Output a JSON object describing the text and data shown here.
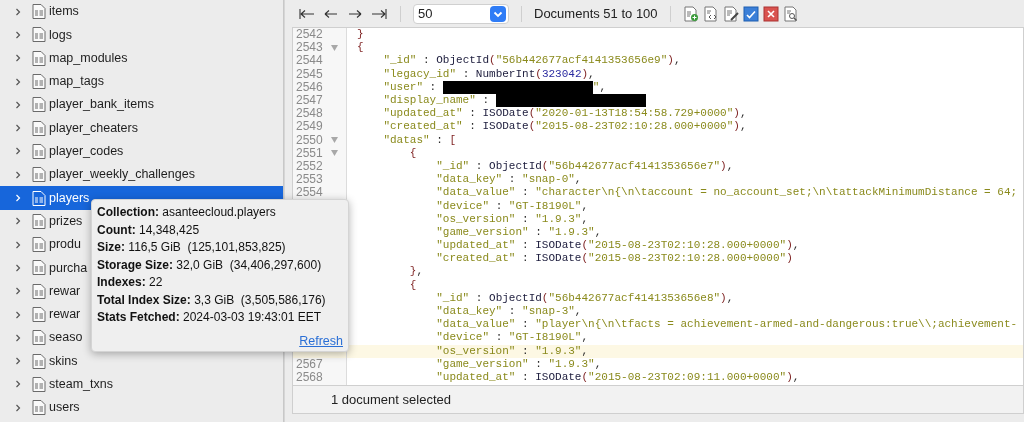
{
  "sidebar": {
    "items": [
      {
        "label": "items",
        "selected": false,
        "expanded": false
      },
      {
        "label": "logs",
        "selected": false,
        "expanded": false
      },
      {
        "label": "map_modules",
        "selected": false,
        "expanded": false
      },
      {
        "label": "map_tags",
        "selected": false,
        "expanded": false
      },
      {
        "label": "player_bank_items",
        "selected": false,
        "expanded": false
      },
      {
        "label": "player_cheaters",
        "selected": false,
        "expanded": false
      },
      {
        "label": "player_codes",
        "selected": false,
        "expanded": false
      },
      {
        "label": "player_weekly_challenges",
        "selected": false,
        "expanded": false
      },
      {
        "label": "players",
        "selected": true,
        "expanded": false
      },
      {
        "label": "prizes",
        "selected": false,
        "expanded": false
      },
      {
        "label": "produ",
        "selected": false,
        "expanded": false
      },
      {
        "label": "purcha",
        "selected": false,
        "expanded": false
      },
      {
        "label": "rewar",
        "selected": false,
        "expanded": false
      },
      {
        "label": "rewar",
        "selected": false,
        "expanded": false
      },
      {
        "label": "seaso",
        "selected": false,
        "expanded": false
      },
      {
        "label": "skins",
        "selected": false,
        "expanded": false
      },
      {
        "label": "steam_txns",
        "selected": false,
        "expanded": false
      },
      {
        "label": "users",
        "selected": false,
        "expanded": false
      }
    ]
  },
  "tooltip": {
    "rows": [
      "**Collection:** asanteecloud.players",
      "**Count:** 14,348,425",
      "**Size:** 116,5 GiB  (125,101,853,825)",
      "**Storage Size:** 32,0 GiB  (34,406,297,600)",
      "**Indexes:** 22",
      "**Total Index Size:** 3,3 GiB  (3,505,586,176)",
      "**Stats Fetched:** 2024-03-03 19:43:01 EET"
    ],
    "link": "Refresh"
  },
  "toolbar": {
    "page_size": "50",
    "range": "Documents 51 to 100"
  },
  "editor": {
    "lines": [
      {
        "number": "2542",
        "fold": false,
        "current": false,
        "segments": [
          {
            "kind": "paren",
            "t": "}"
          }
        ]
      },
      {
        "number": "2543",
        "fold": true,
        "current": false,
        "segments": [
          {
            "kind": "paren",
            "t": "{"
          }
        ]
      },
      {
        "number": "2544",
        "fold": false,
        "current": false,
        "segments": [
          {
            "kind": "key",
            "t": "    \"_id\""
          },
          {
            "kind": "punct",
            "t": " : "
          },
          {
            "kind": "func",
            "t": "ObjectId"
          },
          {
            "kind": "paren",
            "t": "("
          },
          {
            "kind": "string",
            "t": "\"56b442677acf4141353656e9\""
          },
          {
            "kind": "paren",
            "t": ")"
          },
          {
            "kind": "punct",
            "t": ","
          }
        ]
      },
      {
        "number": "2545",
        "fold": false,
        "current": false,
        "segments": [
          {
            "kind": "key",
            "t": "    \"legacy_id\""
          },
          {
            "kind": "punct",
            "t": " : "
          },
          {
            "kind": "func",
            "t": "NumberInt"
          },
          {
            "kind": "paren",
            "t": "("
          },
          {
            "kind": "number",
            "t": "323042"
          },
          {
            "kind": "paren",
            "t": ")"
          },
          {
            "kind": "punct",
            "t": ","
          }
        ]
      },
      {
        "number": "2546",
        "fold": false,
        "current": false,
        "segments": [
          {
            "kind": "key",
            "t": "    \"user\""
          },
          {
            "kind": "punct",
            "t": " : "
          },
          {
            "kind": "redacted"
          },
          {
            "kind": "string",
            "t": "\""
          },
          {
            "kind": "punct",
            "t": ","
          }
        ]
      },
      {
        "number": "2547",
        "fold": false,
        "current": false,
        "segments": [
          {
            "kind": "key",
            "t": "    \"display_name\""
          },
          {
            "kind": "punct",
            "t": " : "
          },
          {
            "kind": "redacted"
          }
        ]
      },
      {
        "number": "2548",
        "fold": false,
        "current": false,
        "segments": [
          {
            "kind": "key",
            "t": "    \"updated_at\""
          },
          {
            "kind": "punct",
            "t": " : "
          },
          {
            "kind": "func",
            "t": "ISODate"
          },
          {
            "kind": "paren",
            "t": "("
          },
          {
            "kind": "string",
            "t": "\"2020-01-13T18:54:58.729+0000\""
          },
          {
            "kind": "paren",
            "t": ")"
          },
          {
            "kind": "punct",
            "t": ","
          }
        ]
      },
      {
        "number": "2549",
        "fold": false,
        "current": false,
        "segments": [
          {
            "kind": "key",
            "t": "    \"created_at\""
          },
          {
            "kind": "punct",
            "t": " : "
          },
          {
            "kind": "func",
            "t": "ISODate"
          },
          {
            "kind": "paren",
            "t": "("
          },
          {
            "kind": "string",
            "t": "\"2015-08-23T02:10:28.000+0000\""
          },
          {
            "kind": "paren",
            "t": ")"
          },
          {
            "kind": "punct",
            "t": ","
          }
        ]
      },
      {
        "number": "2550",
        "fold": true,
        "current": false,
        "segments": [
          {
            "kind": "key",
            "t": "    \"datas\""
          },
          {
            "kind": "punct",
            "t": " : "
          },
          {
            "kind": "paren",
            "t": "["
          }
        ]
      },
      {
        "number": "2551",
        "fold": true,
        "current": false,
        "segments": [
          {
            "kind": "paren",
            "t": "        {"
          }
        ]
      },
      {
        "number": "2552",
        "fold": false,
        "current": false,
        "segments": [
          {
            "kind": "key",
            "t": "            \"_id\""
          },
          {
            "kind": "punct",
            "t": " : "
          },
          {
            "kind": "func",
            "t": "ObjectId"
          },
          {
            "kind": "paren",
            "t": "("
          },
          {
            "kind": "string",
            "t": "\"56b442677acf4141353656e7\""
          },
          {
            "kind": "paren",
            "t": ")"
          },
          {
            "kind": "punct",
            "t": ","
          }
        ]
      },
      {
        "number": "2553",
        "fold": false,
        "current": false,
        "segments": [
          {
            "kind": "key",
            "t": "            \"data_key\""
          },
          {
            "kind": "punct",
            "t": " : "
          },
          {
            "kind": "string",
            "t": "\"snap-0\""
          },
          {
            "kind": "punct",
            "t": ","
          }
        ]
      },
      {
        "number": "2554",
        "fold": false,
        "current": false,
        "segments": [
          {
            "kind": "key",
            "t": "            \"data_value\""
          },
          {
            "kind": "punct",
            "t": " : "
          },
          {
            "kind": "string",
            "t": "\"character\\n{\\n\\taccount = no_account_set;\\n\\tattackMinimumDistance = 64;"
          }
        ]
      },
      {
        "fold": false,
        "current": false,
        "segments": [
          {
            "kind": "key",
            "t": "            \"device\""
          },
          {
            "kind": "punct",
            "t": " : "
          },
          {
            "kind": "string",
            "t": "\"GT-I8190L\""
          },
          {
            "kind": "punct",
            "t": ","
          }
        ]
      },
      {
        "fold": false,
        "current": false,
        "segments": [
          {
            "kind": "key",
            "t": "            \"os_version\""
          },
          {
            "kind": "punct",
            "t": " : "
          },
          {
            "kind": "string",
            "t": "\"1.9.3\""
          },
          {
            "kind": "punct",
            "t": ","
          }
        ]
      },
      {
        "fold": false,
        "current": false,
        "segments": [
          {
            "kind": "key",
            "t": "            \"game_version\""
          },
          {
            "kind": "punct",
            "t": " : "
          },
          {
            "kind": "string",
            "t": "\"1.9.3\""
          },
          {
            "kind": "punct",
            "t": ","
          }
        ]
      },
      {
        "fold": false,
        "current": false,
        "segments": [
          {
            "kind": "key",
            "t": "            \"updated_at\""
          },
          {
            "kind": "punct",
            "t": " : "
          },
          {
            "kind": "func",
            "t": "ISODate"
          },
          {
            "kind": "paren",
            "t": "("
          },
          {
            "kind": "string",
            "t": "\"2015-08-23T02:10:28.000+0000\""
          },
          {
            "kind": "paren",
            "t": ")"
          },
          {
            "kind": "punct",
            "t": ","
          }
        ]
      },
      {
        "fold": false,
        "current": false,
        "segments": [
          {
            "kind": "key",
            "t": "            \"created_at\""
          },
          {
            "kind": "punct",
            "t": " : "
          },
          {
            "kind": "func",
            "t": "ISODate"
          },
          {
            "kind": "paren",
            "t": "("
          },
          {
            "kind": "string",
            "t": "\"2015-08-23T02:10:28.000+0000\""
          },
          {
            "kind": "paren",
            "t": ")"
          }
        ]
      },
      {
        "fold": false,
        "current": false,
        "segments": [
          {
            "kind": "paren",
            "t": "        }"
          },
          {
            "kind": "punct",
            "t": ","
          }
        ]
      },
      {
        "fold": false,
        "current": false,
        "segments": [
          {
            "kind": "paren",
            "t": "        {"
          }
        ]
      },
      {
        "fold": false,
        "current": false,
        "segments": [
          {
            "kind": "key",
            "t": "            \"_id\""
          },
          {
            "kind": "punct",
            "t": " : "
          },
          {
            "kind": "func",
            "t": "ObjectId"
          },
          {
            "kind": "paren",
            "t": "("
          },
          {
            "kind": "string",
            "t": "\"56b442677acf4141353656e8\""
          },
          {
            "kind": "paren",
            "t": ")"
          },
          {
            "kind": "punct",
            "t": ","
          }
        ]
      },
      {
        "fold": false,
        "current": false,
        "segments": [
          {
            "kind": "key",
            "t": "            \"data_key\""
          },
          {
            "kind": "punct",
            "t": " : "
          },
          {
            "kind": "string",
            "t": "\"snap-3\""
          },
          {
            "kind": "punct",
            "t": ","
          }
        ]
      },
      {
        "fold": false,
        "current": false,
        "segments": [
          {
            "kind": "key",
            "t": "            \"data_value\""
          },
          {
            "kind": "punct",
            "t": " : "
          },
          {
            "kind": "string",
            "t": "\"player\\n{\\n\\tfacts = achievement-armed-and-dangerous:true\\\\;achievement-"
          }
        ]
      },
      {
        "fold": false,
        "current": false,
        "segments": [
          {
            "kind": "key",
            "t": "            \"device\""
          },
          {
            "kind": "punct",
            "t": " : "
          },
          {
            "kind": "string",
            "t": "\"GT-I8190L\""
          },
          {
            "kind": "punct",
            "t": ","
          }
        ]
      },
      {
        "fold": false,
        "current": true,
        "segments": [
          {
            "kind": "key",
            "t": "            \"os_version\""
          },
          {
            "kind": "punct",
            "t": " : "
          },
          {
            "kind": "string",
            "t": "\"1.9.3\""
          },
          {
            "kind": "punct",
            "t": ","
          }
        ]
      },
      {
        "number": "2567",
        "fold": false,
        "current": false,
        "segments": [
          {
            "kind": "key",
            "t": "            \"game_version\""
          },
          {
            "kind": "punct",
            "t": " : "
          },
          {
            "kind": "string",
            "t": "\"1.9.3\""
          },
          {
            "kind": "punct",
            "t": ","
          }
        ]
      },
      {
        "number": "2568",
        "fold": false,
        "current": false,
        "segments": [
          {
            "kind": "key",
            "t": "            \"updated_at\""
          },
          {
            "kind": "punct",
            "t": " : "
          },
          {
            "kind": "func",
            "t": "ISODate"
          },
          {
            "kind": "paren",
            "t": "("
          },
          {
            "kind": "string",
            "t": "\"2015-08-23T02:09:11.000+0000\""
          },
          {
            "kind": "paren",
            "t": ")"
          },
          {
            "kind": "punct",
            "t": ","
          }
        ]
      }
    ]
  },
  "status_bar": "1 document selected"
}
